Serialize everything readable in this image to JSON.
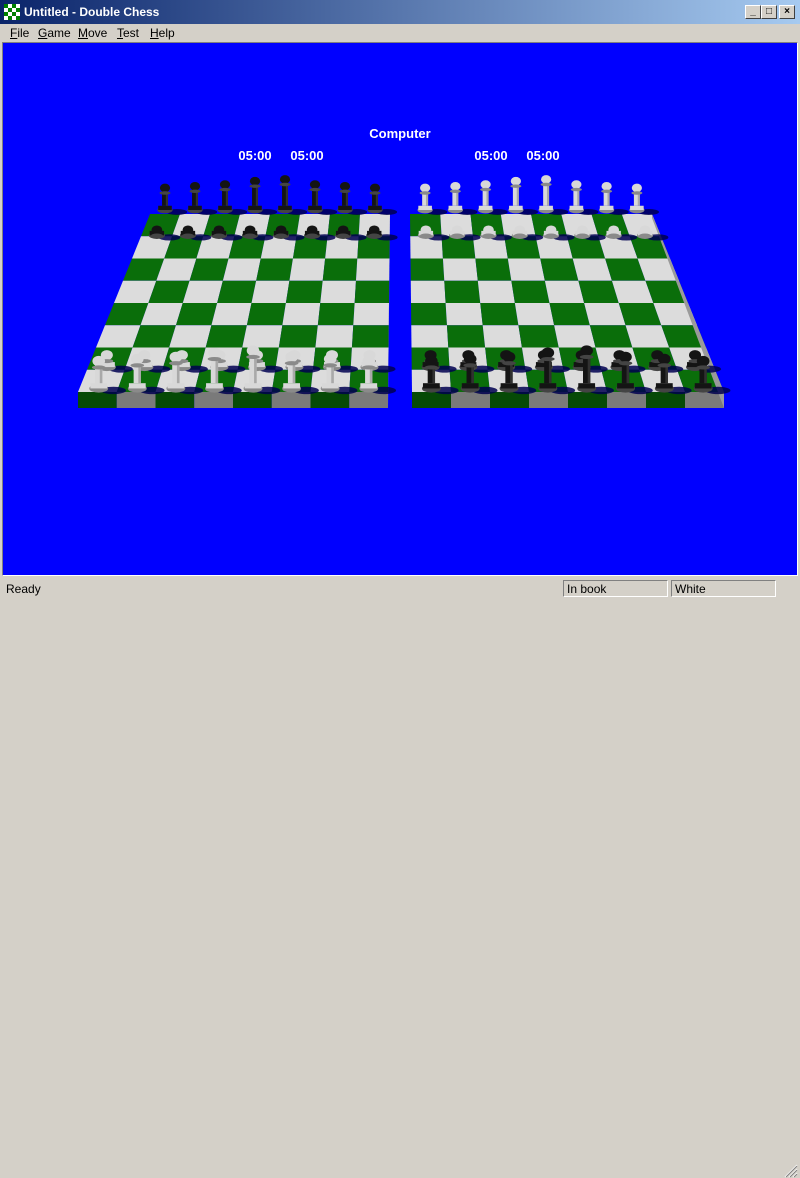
{
  "window": {
    "title": "Untitled - Double Chess",
    "buttons": {
      "minimize": "_",
      "maximize": "□",
      "close": "×"
    }
  },
  "menu": {
    "items": [
      {
        "label": "File"
      },
      {
        "label": "Game"
      },
      {
        "label": "Move"
      },
      {
        "label": "Test"
      },
      {
        "label": "Help"
      }
    ]
  },
  "board_view": {
    "background": "#0000ff",
    "player_label": "Computer",
    "clocks": [
      "05:00",
      "05:00",
      "05:00",
      "05:00"
    ],
    "square_colors": {
      "dark": "#0a6e0a",
      "light": "#dcdcdc"
    }
  },
  "status": {
    "ready": "Ready",
    "book": "In book",
    "side": "White"
  },
  "icons": {
    "app": "chess-app-icon",
    "grip": "resize-grip-icon"
  }
}
